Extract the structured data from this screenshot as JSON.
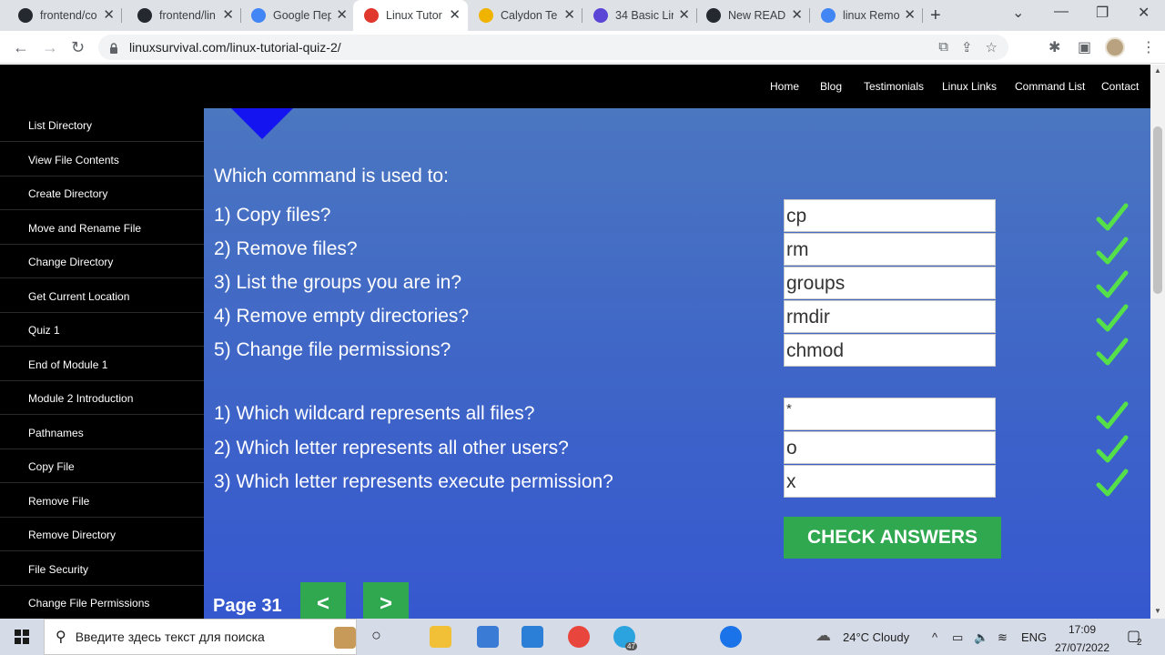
{
  "browser": {
    "tabs": [
      {
        "title": "frontend/co",
        "icon": "github-icon",
        "color": "#24292f"
      },
      {
        "title": "frontend/lin",
        "icon": "github-icon",
        "color": "#24292f"
      },
      {
        "title": "Google Пер",
        "icon": "google-translate-icon",
        "color": "#4285f4"
      },
      {
        "title": "Linux Tutor",
        "icon": "linux-tutorial-icon",
        "color": "#e0382c"
      },
      {
        "title": "Calydon Te",
        "icon": "calydon-icon",
        "color": "#f0b400"
      },
      {
        "title": "34 Basic Lin",
        "icon": "hashnode-icon",
        "color": "#5b45d6"
      },
      {
        "title": "New READM",
        "icon": "github-icon",
        "color": "#24292f"
      },
      {
        "title": "linux Remo",
        "icon": "google-icon",
        "color": "#4285f4"
      }
    ],
    "url": "linuxsurvival.com/linux-tutorial-quiz-2/"
  },
  "topnav": [
    "Home",
    "Blog",
    "Testimonials",
    "Linux Links",
    "Command List",
    "Contact"
  ],
  "sidebar": [
    "List Directory",
    "View File Contents",
    "Create Directory",
    "Move and Rename File",
    "Change Directory",
    "Get Current Location",
    "Quiz 1",
    "End of Module 1",
    "Module 2 Introduction",
    "Pathnames",
    "Copy File",
    "Remove File",
    "Remove Directory",
    "File Security",
    "Change File Permissions"
  ],
  "quiz": {
    "heading": "Which command is used to:",
    "group1": [
      {
        "q": "1) Copy files?",
        "a": "cp"
      },
      {
        "q": "2) Remove files?",
        "a": "rm"
      },
      {
        "q": "3) List the groups you are in?",
        "a": "groups"
      },
      {
        "q": "4) Remove empty directories?",
        "a": "rmdir"
      },
      {
        "q": "5) Change file permissions?",
        "a": "chmod"
      }
    ],
    "group2": [
      {
        "q": "1) Which wildcard represents all files?",
        "a": "*"
      },
      {
        "q": "2) Which letter represents all other users?",
        "a": "o"
      },
      {
        "q": "3) Which letter represents execute permission?",
        "a": "x"
      }
    ],
    "check_label": "CHECK ANSWERS",
    "page_label": "Page 31",
    "prev_label": "<",
    "next_label": ">"
  },
  "taskbar": {
    "search_placeholder": "Введите здесь текст для поиска",
    "weather": "24°C  Cloudy",
    "lang": "ENG",
    "time": "17:09",
    "date": "27/07/2022",
    "notif_count": "2",
    "telegram_badge": "47"
  },
  "colors": {
    "accent_green": "#2fa84f",
    "check_green": "#55e04a"
  }
}
